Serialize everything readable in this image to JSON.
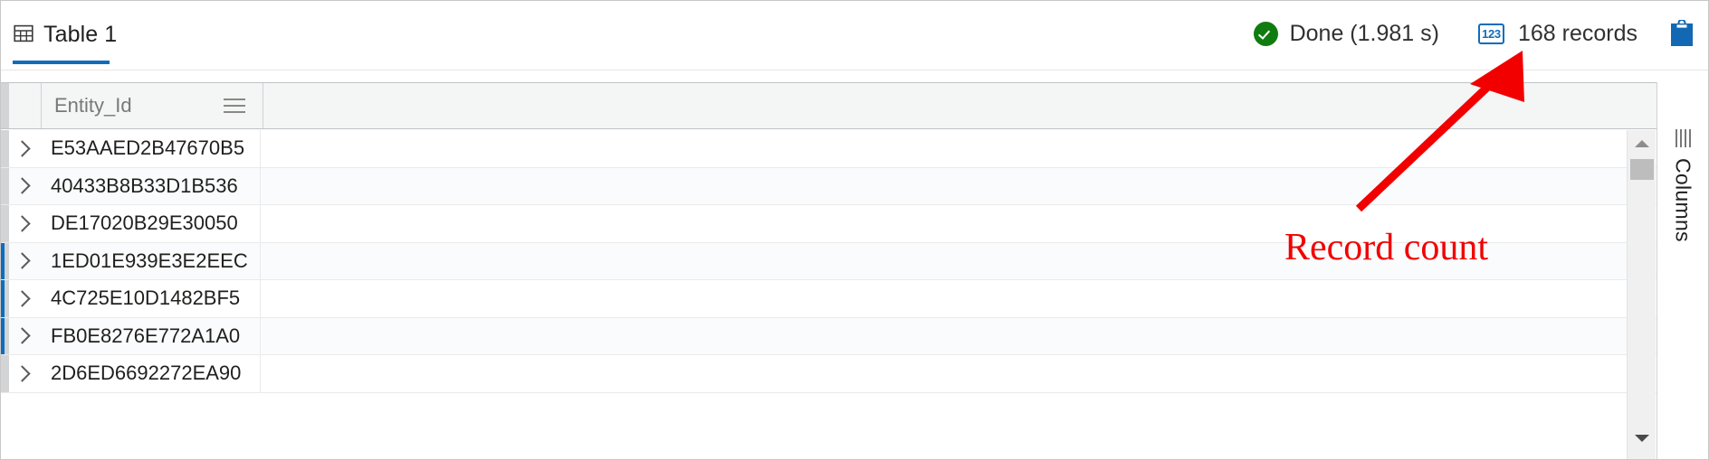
{
  "window": {
    "tab": {
      "label": "Table 1",
      "icon": "table-grid-icon",
      "accent_color": "#0f6cbd"
    }
  },
  "status": {
    "done": {
      "icon": "green-check-circle-icon",
      "label": "Done (1.981 s)",
      "color": "#107c10"
    },
    "records": {
      "icon": "numeric-123-badge-icon",
      "badge_text": "123",
      "label": "168 records",
      "count": 168,
      "color": "#0f6cbd"
    },
    "clipboard": {
      "icon": "clipboard-icon",
      "color": "#1268b3"
    }
  },
  "grid": {
    "columns": [
      {
        "name": "Entity_Id",
        "menu_icon": "hamburger-menu-icon"
      }
    ],
    "rows": [
      {
        "expander": "chevron-right-icon",
        "Entity_Id": "E53AAED2B47670B5",
        "selected": false
      },
      {
        "expander": "chevron-right-icon",
        "Entity_Id": "40433B8B33D1B536",
        "selected": false
      },
      {
        "expander": "chevron-right-icon",
        "Entity_Id": "DE17020B29E30050",
        "selected": false
      },
      {
        "expander": "chevron-right-icon",
        "Entity_Id": "1ED01E939E3E2EEC",
        "selected": true
      },
      {
        "expander": "chevron-right-icon",
        "Entity_Id": "4C725E10D1482BF5",
        "selected": true
      },
      {
        "expander": "chevron-right-icon",
        "Entity_Id": "FB0E8276E772A1A0",
        "selected": true
      },
      {
        "expander": "chevron-right-icon",
        "Entity_Id": "2D6ED6692272EA90",
        "selected": false
      }
    ]
  },
  "scrollbar": {
    "up_arrow_icon": "triangle-up-icon",
    "down_arrow_icon": "triangle-down-icon",
    "orientation": "vertical"
  },
  "columns_panel": {
    "label": "Columns",
    "icon": "columns-bars-icon"
  },
  "annotation": {
    "text": "Record count",
    "color": "#f20000",
    "arrow_icon": "red-arrow-icon"
  }
}
